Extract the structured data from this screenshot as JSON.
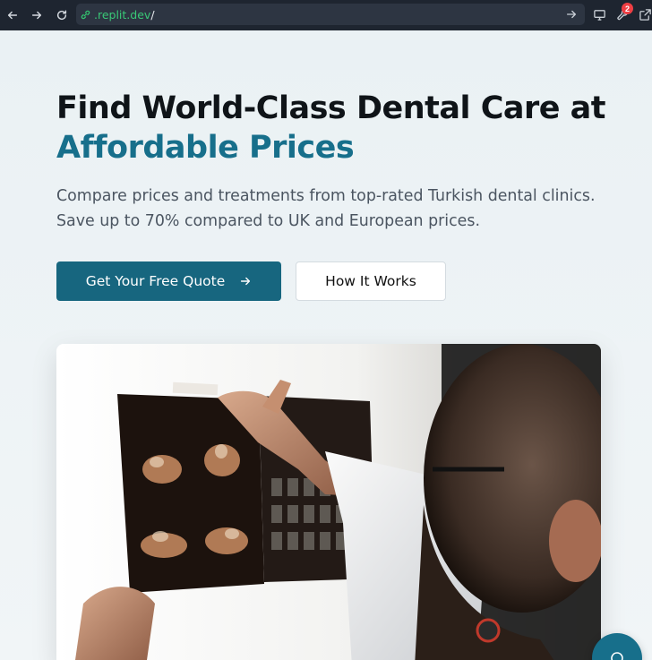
{
  "browser": {
    "url_host": ".replit.dev",
    "url_path": "/",
    "notification_count": "2"
  },
  "hero": {
    "title_line1": "Find World-Class Dental Care at",
    "title_line2": "Affordable Prices",
    "subtitle": "Compare prices and treatments from top-rated Turkish dental clinics. Save up to 70% compared to UK and European prices.",
    "primary_cta": "Get Your Free Quote",
    "secondary_cta": "How It Works"
  },
  "colors": {
    "brand": "#176f8b",
    "primary_button": "#17667f",
    "chrome_bg": "#1e2530",
    "url_green": "#39c877"
  },
  "icons": {
    "back": "arrow-left-icon",
    "forward": "arrow-right-icon",
    "reload": "reload-icon",
    "link": "link-icon",
    "chat": "chat-icon"
  }
}
